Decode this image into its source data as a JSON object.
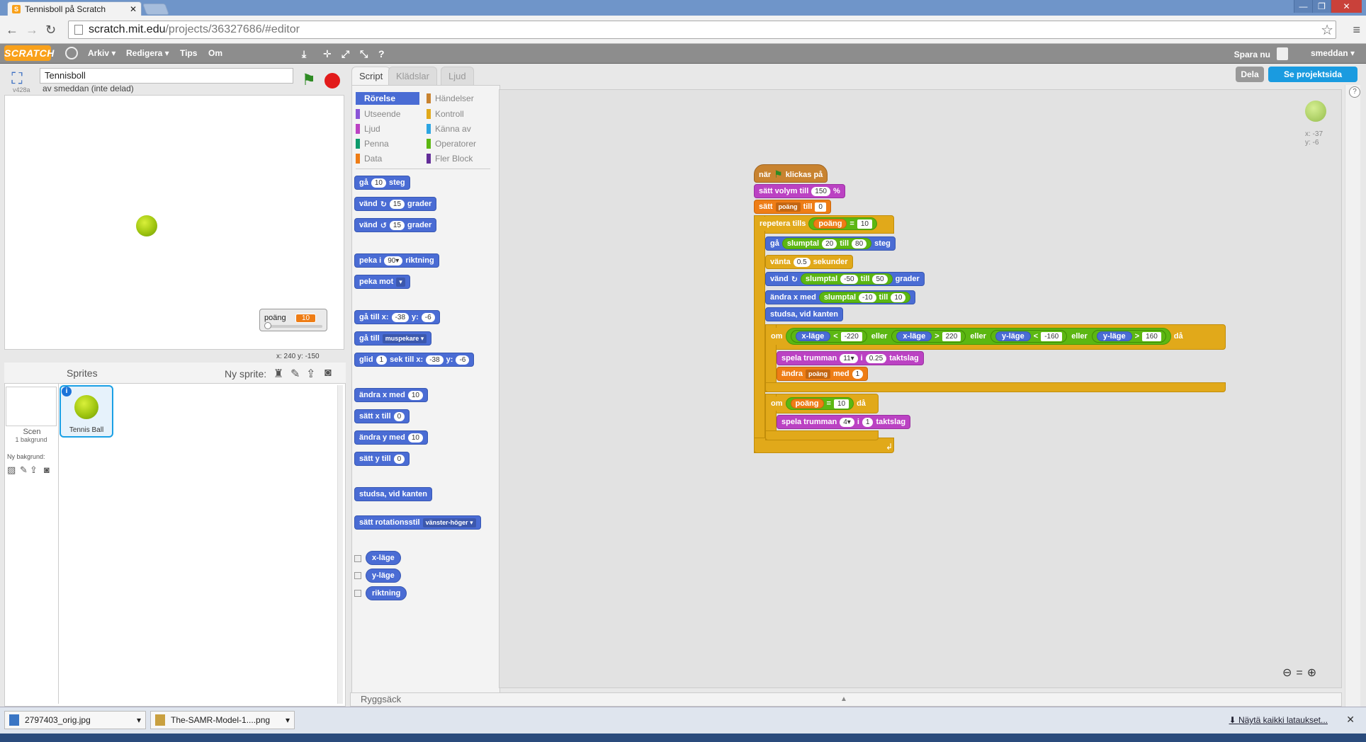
{
  "browser": {
    "tab_title": "Tennisboll på Scratch",
    "url_host": "scratch.mit.edu",
    "url_path": "/projects/36327686/#editor"
  },
  "scratch_bar": {
    "logo": "SCRATCH",
    "menu": [
      "Arkiv ▾",
      "Redigera ▾",
      "Tips",
      "Om"
    ],
    "save_now": "Spara nu",
    "username": "smeddan ▾"
  },
  "stage": {
    "version": "v428a",
    "project_title": "Tennisboll",
    "project_by": "av smeddan (inte delad)",
    "monitor_label": "poäng",
    "monitor_value": "10",
    "coords": "x: 240   y: -150"
  },
  "sprites": {
    "header": "Sprites",
    "new_sprite": "Ny sprite:",
    "scene_label": "Scen",
    "scene_sub": "1 bakgrund",
    "new_backdrop": "Ny bakgrund:",
    "sprite_name": "Tennis Ball"
  },
  "tabs": [
    "Script",
    "Klädslar",
    "Ljud"
  ],
  "categories": {
    "left": [
      {
        "label": "Rörelse",
        "color": "#4a6cd4"
      },
      {
        "label": "Utseende",
        "color": "#8a55d7"
      },
      {
        "label": "Ljud",
        "color": "#bb42c3"
      },
      {
        "label": "Penna",
        "color": "#0e9a6c"
      },
      {
        "label": "Data",
        "color": "#ee7d16"
      }
    ],
    "right": [
      {
        "label": "Händelser",
        "color": "#c88330"
      },
      {
        "label": "Kontroll",
        "color": "#e1a91a"
      },
      {
        "label": "Känna av",
        "color": "#2ca5e2"
      },
      {
        "label": "Operatorer",
        "color": "#5cb712"
      },
      {
        "label": "Fler Block",
        "color": "#632d99"
      }
    ]
  },
  "palette": {
    "go": "gå",
    "steps": "steg",
    "v10": "10",
    "turn": "vänd",
    "v15": "15",
    "degrees": "grader",
    "point": "peka i",
    "v90": "90▾",
    "direction": "riktning",
    "point_towards": "peka mot",
    "goto_xy": "gå till x:",
    "vm38": "-38",
    "y": "y:",
    "vm6": "-6",
    "goto": "gå till",
    "mouse": "muspekare ▾",
    "glide": "glid",
    "v1": "1",
    "glide_mid": "sek till x:",
    "change_x": "ändra x med",
    "set_x": "sätt x till",
    "change_y": "ändra y med",
    "set_y": "sätt y till",
    "v0": "0",
    "bounce": "studsa, vid kanten",
    "rot_style": "sätt rotationsstil",
    "rot_val": "vänster-höger ▾",
    "x_pos": "x-läge",
    "y_pos": "y-läge",
    "dir": "riktning"
  },
  "script": {
    "when": "när",
    "clicked": "klickas på",
    "set_volume": "sätt volym till",
    "v150": "150",
    "percent": "%",
    "set": "sätt",
    "var": "poäng",
    "to": "till",
    "v0": "0",
    "repeat_until": "repetera tills",
    "eq": "=",
    "v10": "10",
    "go": "gå",
    "random": "slumptal",
    "v20": "20",
    "v80": "80",
    "steps": "steg",
    "wait": "vänta",
    "v05": "0.5",
    "seconds": "sekunder",
    "turn": "vänd",
    "vm50": "-50",
    "v50": "50",
    "degrees": "grader",
    "change_x": "ändra x med",
    "vm10": "-10",
    "bounce": "studsa, vid kanten",
    "if": "om",
    "x_pos": "x-läge",
    "lt": "<",
    "vm220": "-220",
    "or": "eller",
    "gt": ">",
    "v220": "220",
    "y_pos": "y-läge",
    "vm160": "-160",
    "v160": "160",
    "then": "då",
    "play_drum": "spela trumman",
    "v11": "11▾",
    "for": "i",
    "v025": "0.25",
    "beats": "taktslag",
    "change": "ändra",
    "with": "med",
    "v1": "1",
    "v4": "4▾"
  },
  "sprite_info": {
    "x": "x: -37",
    "y": "y: -6"
  },
  "backpack": "Ryggsäck",
  "right_buttons": {
    "share": "Dela",
    "see_project": "Se projektsida"
  },
  "downloads": {
    "file1": "2797403_orig.jpg",
    "file2": "The-SAMR-Model-1....png",
    "show_all": "Näytä kaikki lataukset..."
  }
}
